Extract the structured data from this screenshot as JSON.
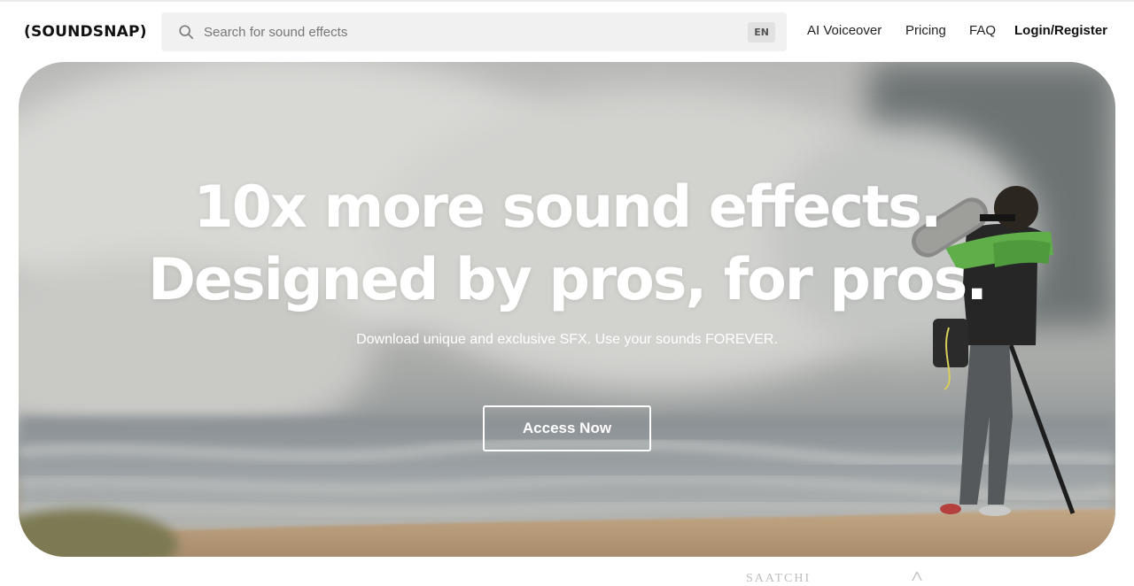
{
  "brand": {
    "logo_text": "(SOUNDSNAP)"
  },
  "search": {
    "placeholder": "Search for sound effects",
    "value": "",
    "language": "EN"
  },
  "nav": {
    "items": [
      {
        "label": "AI Voiceover"
      },
      {
        "label": "Pricing"
      },
      {
        "label": "FAQ"
      },
      {
        "label": "Login/Register"
      }
    ]
  },
  "hero": {
    "headline_line1": "10x more sound effects.",
    "headline_line2": "Designed by pros, for pros.",
    "subheadline": "Download unique and exclusive SFX. Use your sounds FOREVER.",
    "cta_label": "Access Now"
  },
  "partners": {
    "items": [
      "SAATCHI"
    ]
  },
  "colors": {
    "hero_text": "#ffffff",
    "search_bg": "#f1f1f1",
    "jacket": "#5fae4a",
    "sand": "#b39675"
  }
}
